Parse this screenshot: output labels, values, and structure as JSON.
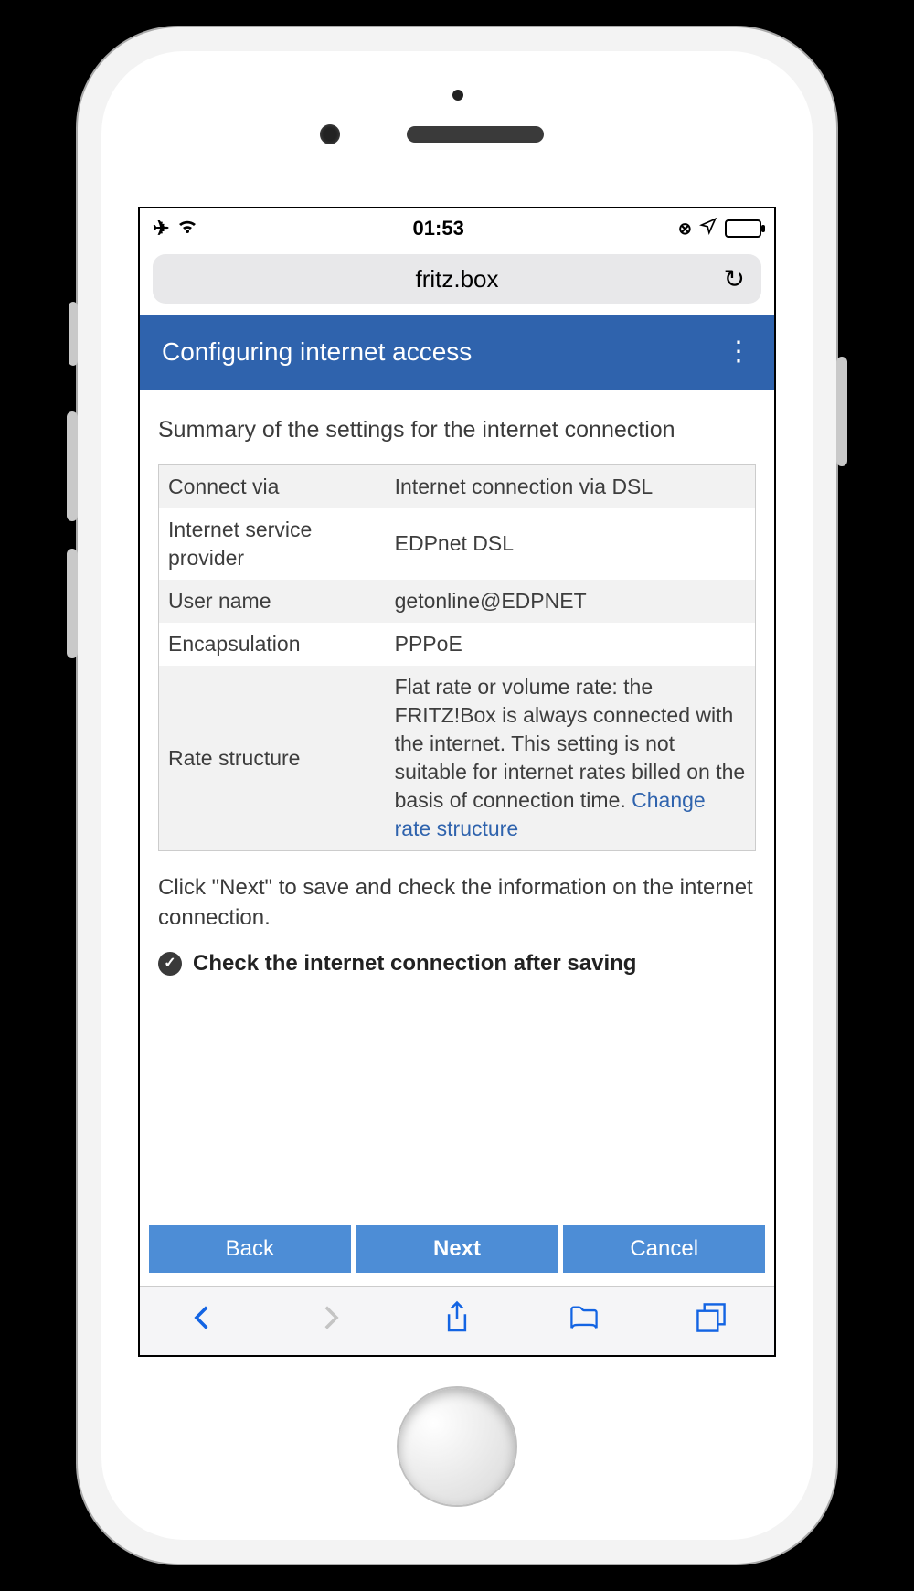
{
  "status": {
    "time": "01:53"
  },
  "browser": {
    "url": "fritz.box"
  },
  "header": {
    "title": "Configuring internet access"
  },
  "content": {
    "summary_heading": "Summary of the settings for the internet connection",
    "rows": {
      "connect_via": {
        "label": "Connect via",
        "value": "Internet connection via DSL"
      },
      "isp": {
        "label": "Internet service provider",
        "value": "EDPnet DSL"
      },
      "username": {
        "label": "User name",
        "value": "getonline@EDPNET"
      },
      "encapsulation": {
        "label": "Encapsulation",
        "value": "PPPoE"
      },
      "rate": {
        "label": "Rate structure",
        "value": "Flat rate or volume rate: the FRITZ!Box is always connected with the internet. This setting is not suitable for internet rates billed on the basis of connection time. ",
        "link": "Change rate structure"
      }
    },
    "instruction": "Click \"Next\" to save and check the information on the internet connection.",
    "checkbox_label": "Check the internet connection after saving"
  },
  "buttons": {
    "back": "Back",
    "next": "Next",
    "cancel": "Cancel"
  }
}
